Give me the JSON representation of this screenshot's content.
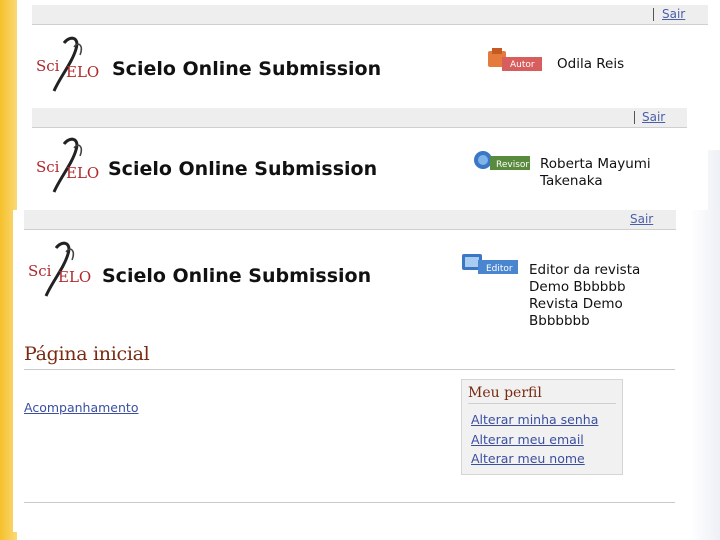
{
  "app": {
    "title": "Scielo Online Submission"
  },
  "logo": {
    "text_sci": "Sci",
    "text_elo": "ELO"
  },
  "header1": {
    "logout": "Sair",
    "profile_badge": "Perfil Autor",
    "badge_word": "Autor",
    "user": "Odila Reis"
  },
  "header2": {
    "logout": "Sair",
    "profile_badge": "Perfil Revisor",
    "badge_word": "Revisor",
    "user_line1": "Roberta Mayumi",
    "user_line2": "Takenaka"
  },
  "header3": {
    "logout": "Sair",
    "profile_badge": "Perfil Editor",
    "badge_word": "Editor",
    "role_line1": "Editor da revista",
    "role_line2": "Demo Bbbbbb",
    "journal_line1": "Revista Demo",
    "journal_line2": "Bbbbbbb"
  },
  "page": {
    "heading": "Página inicial",
    "link_tracking": "Acompanhamento"
  },
  "profile_box": {
    "title": "Meu perfil",
    "items": [
      "Alterar minha senha",
      "Alterar meu email",
      "Alterar meu nome"
    ]
  },
  "colors": {
    "accent_stripe": "#f5c02a",
    "heading": "#7a2a10",
    "link": "#3b4fa0"
  }
}
